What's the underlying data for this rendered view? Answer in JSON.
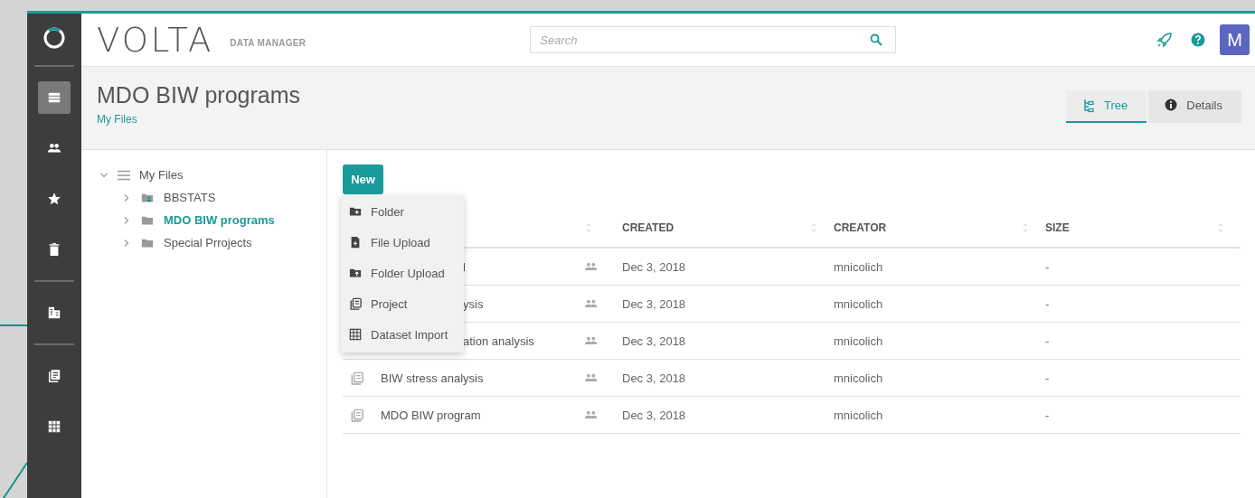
{
  "sidebar": {
    "items": [
      {
        "kind": "list",
        "selected": true
      },
      {
        "kind": "people",
        "selected": false
      },
      {
        "kind": "star",
        "selected": false
      },
      {
        "kind": "trash",
        "selected": false
      },
      {
        "kind": "divider"
      },
      {
        "kind": "buildings",
        "selected": false
      },
      {
        "kind": "divider"
      },
      {
        "kind": "projects",
        "selected": false
      },
      {
        "kind": "grid",
        "selected": false
      }
    ]
  },
  "header": {
    "logo": "VOLTA",
    "subtitle": "DATA MANAGER",
    "search": {
      "placeholder": "Search"
    },
    "avatar": "M"
  },
  "page": {
    "title": "MDO BIW programs",
    "breadcrumb": "My Files"
  },
  "view_tabs": [
    {
      "label": "Tree",
      "kind": "tree",
      "selected": true
    },
    {
      "label": "Details",
      "kind": "info",
      "selected": false
    }
  ],
  "tree": {
    "label": "My Files",
    "expanded": true,
    "children": [
      {
        "label": "BBSTATS",
        "kind": "shared-folder",
        "selected": false
      },
      {
        "label": "MDO BIW programs",
        "kind": "folder",
        "selected": true
      },
      {
        "label": "Special Prrojects",
        "kind": "folder",
        "selected": false
      }
    ]
  },
  "new_button": "New",
  "new_menu": [
    {
      "label": "Folder",
      "kind": "folder"
    },
    {
      "label": "File Upload",
      "kind": "file"
    },
    {
      "label": "Folder Upload",
      "kind": "folder-upload"
    },
    {
      "label": "Project",
      "kind": "project"
    },
    {
      "label": "Dataset Import",
      "kind": "grid"
    }
  ],
  "table": {
    "columns": [
      "CREATED",
      "CREATOR",
      "SIZE"
    ],
    "rows": [
      {
        "name": "l",
        "covered": true,
        "created": "Dec 3, 2018",
        "creator": "mnicolich",
        "size": "-"
      },
      {
        "name": "ysis",
        "covered": true,
        "created": "Dec 3, 2018",
        "creator": "mnicolich",
        "size": "-"
      },
      {
        "name": "ation analysis",
        "covered": true,
        "created": "Dec 3, 2018",
        "creator": "mnicolich",
        "size": "-"
      },
      {
        "name": "BIW stress analysis",
        "covered": false,
        "created": "Dec 3, 2018",
        "creator": "mnicolich",
        "size": "-"
      },
      {
        "name": "MDO BIW program",
        "covered": false,
        "created": "Dec 3, 2018",
        "creator": "mnicolich",
        "size": "-"
      }
    ]
  }
}
